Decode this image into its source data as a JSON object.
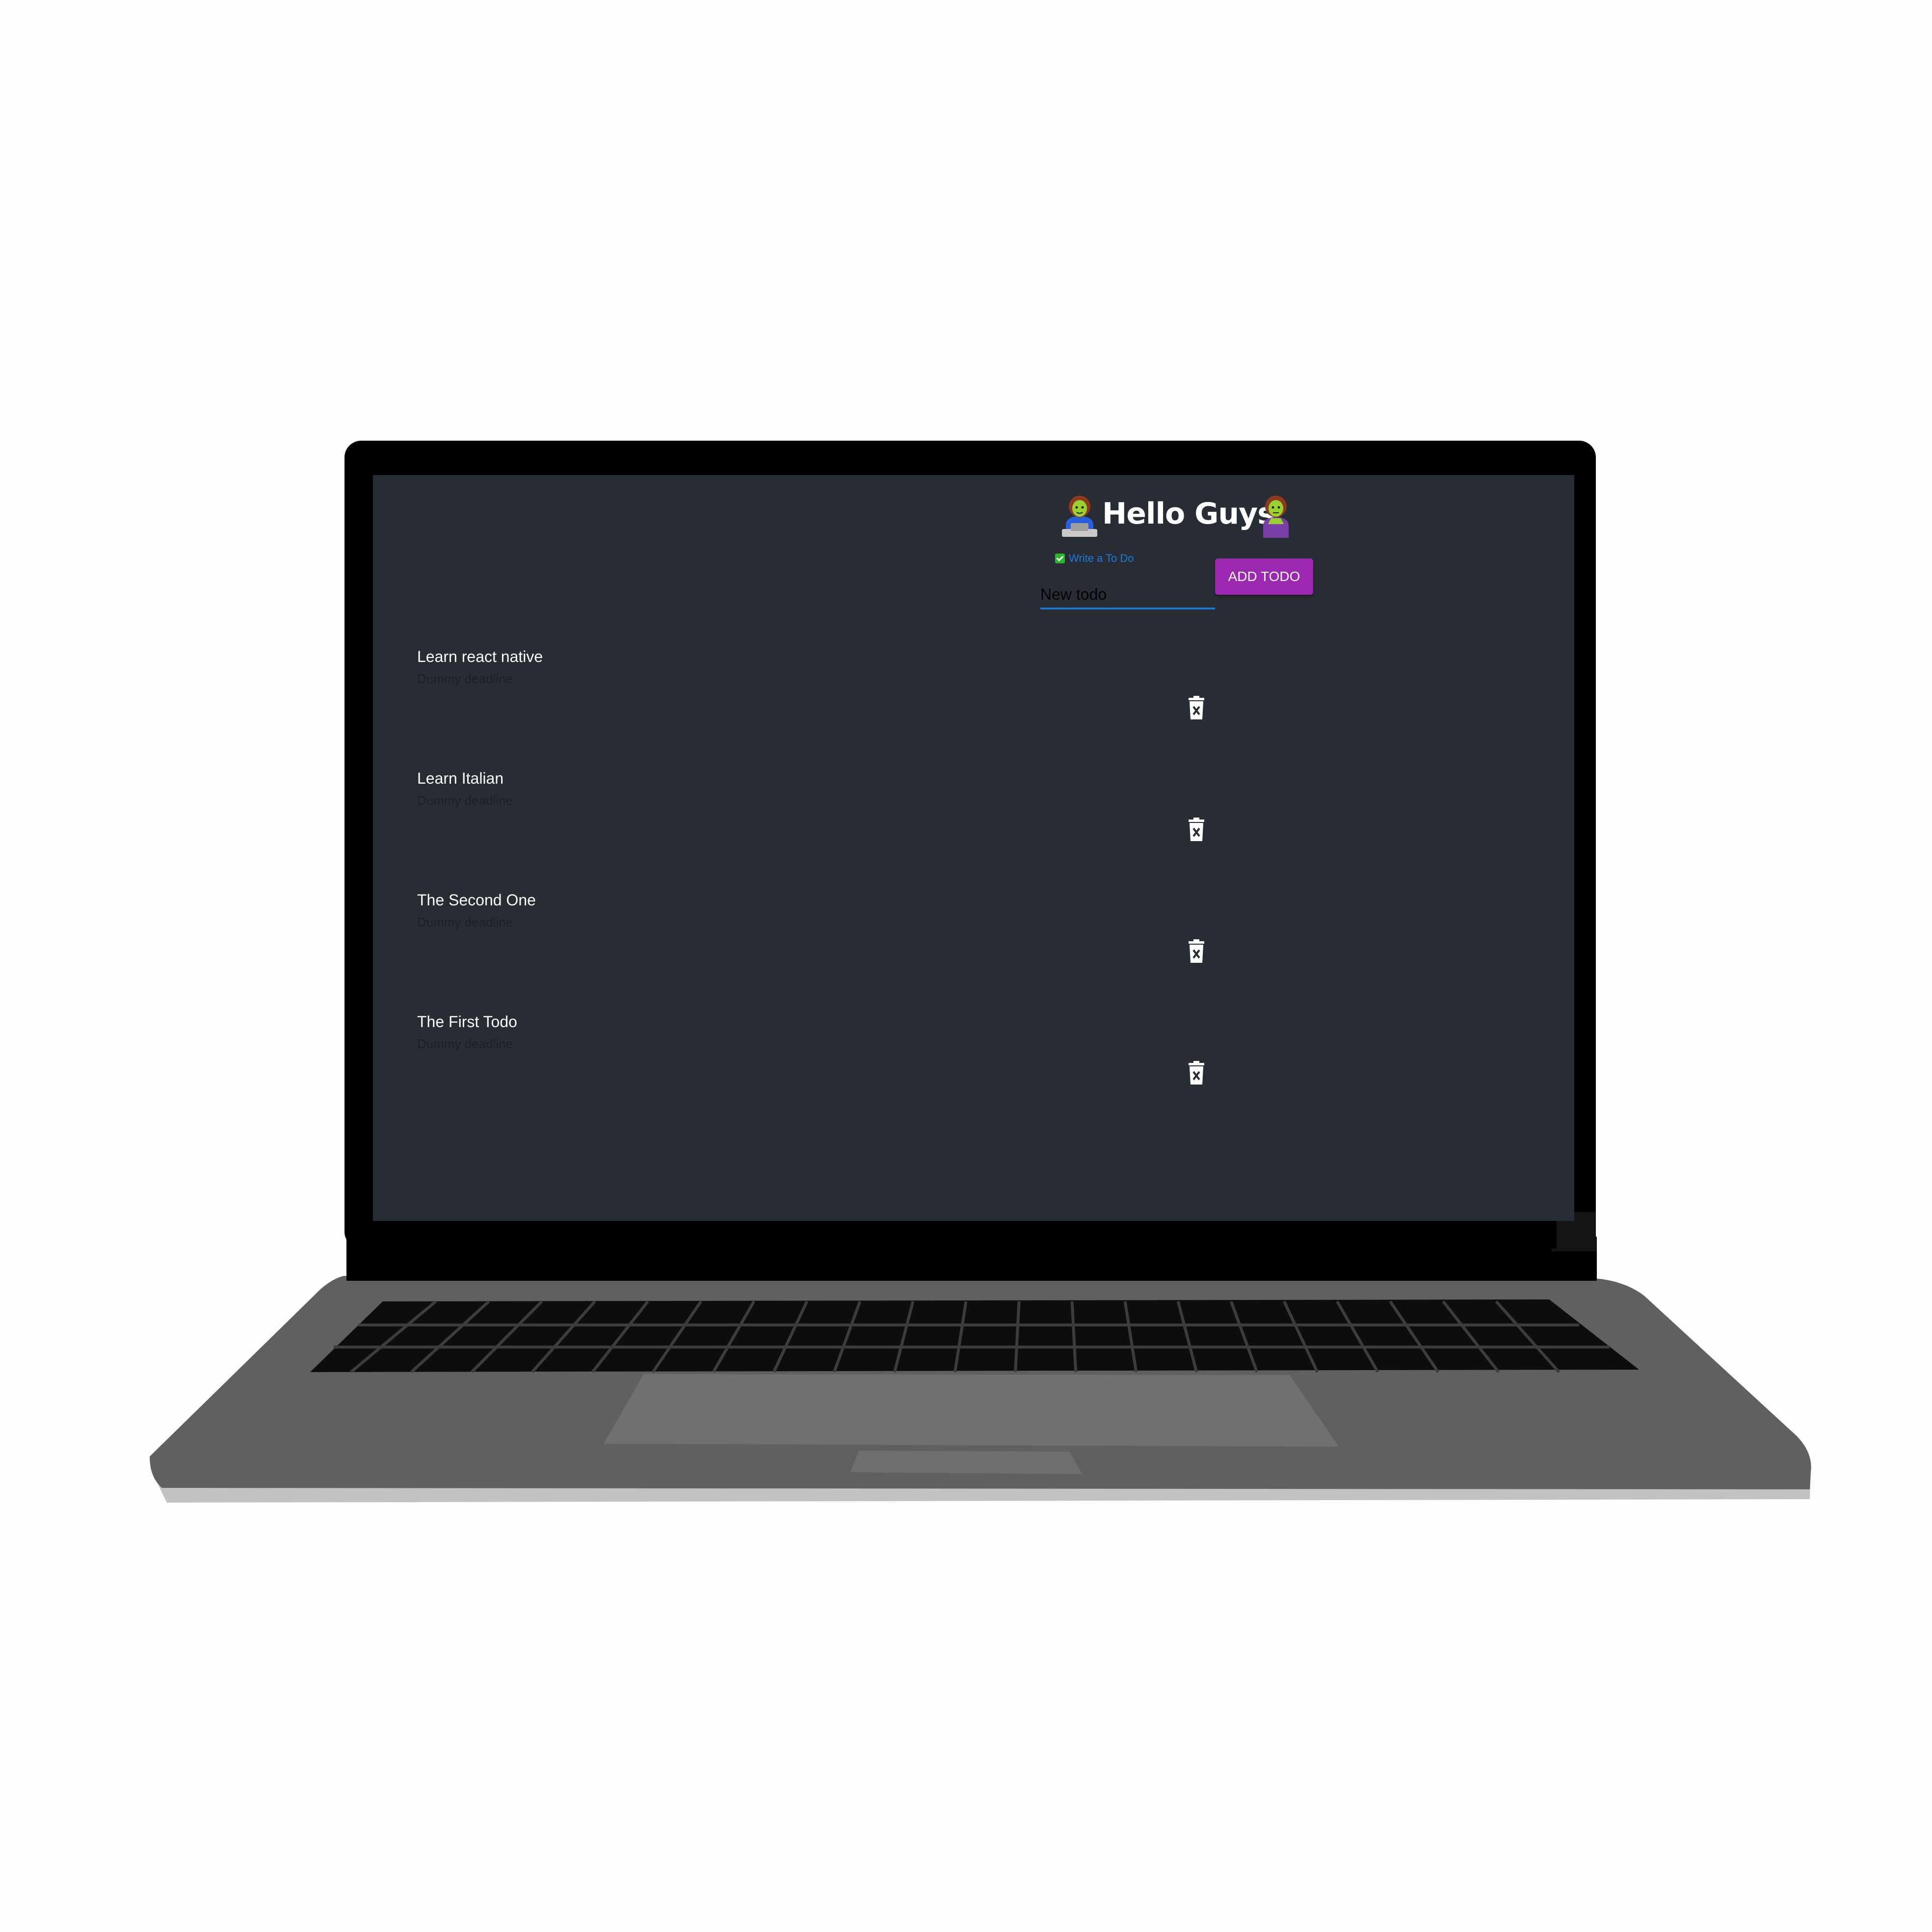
{
  "app": {
    "title": "Hello Guys",
    "left_emoji_icon": "woman-technologist-icon",
    "right_emoji_icon": "woman-zombie-icon"
  },
  "form": {
    "label": "Write a To Do",
    "label_icon": "checkbox-checked-icon",
    "input_value": "New todo",
    "add_button_label": "ADD TODO"
  },
  "todos": [
    {
      "text": "Learn react native",
      "deadline": "Dummy deadline"
    },
    {
      "text": "Learn Italian",
      "deadline": "Dummy deadline"
    },
    {
      "text": "The Second One",
      "deadline": "Dummy deadline"
    },
    {
      "text": "The First Todo",
      "deadline": "Dummy deadline"
    }
  ],
  "icons": {
    "delete": "trash-icon"
  },
  "colors": {
    "screen_background": "#282c34",
    "accent_button": "#9c27b0",
    "input_underline": "#1976d2",
    "label_text": "#1e7ad6",
    "laptop_bezel": "#000000",
    "laptop_body": "#606060"
  }
}
